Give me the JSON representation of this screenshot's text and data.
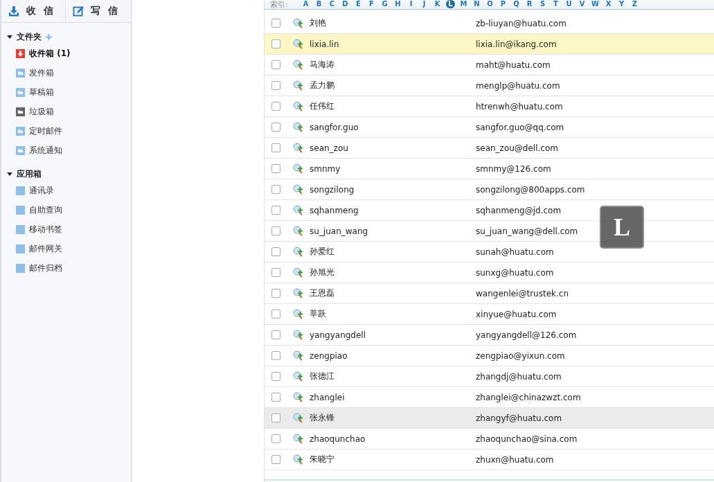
{
  "toolbar": {
    "buttons": [
      {
        "kind": "receive",
        "label": "收 信"
      },
      {
        "kind": "compose",
        "label": "写 信"
      }
    ]
  },
  "sidebar": {
    "sections": [
      {
        "title": "文件夹",
        "expanded": true,
        "can_add": true,
        "items": [
          {
            "kind": "inbox",
            "label": "收件箱",
            "count": "(1)"
          },
          {
            "kind": "folder",
            "label": "发件箱"
          },
          {
            "kind": "folder",
            "label": "草稿箱"
          },
          {
            "kind": "trash",
            "label": "垃圾箱"
          },
          {
            "kind": "folder",
            "label": "定时邮件"
          },
          {
            "kind": "folder",
            "label": "系统通知"
          }
        ]
      },
      {
        "title": "应用箱",
        "expanded": true,
        "items": [
          {
            "kind": "app",
            "label": "通讯录"
          },
          {
            "kind": "app",
            "label": "自助查询"
          },
          {
            "kind": "app",
            "label": "移动书签"
          },
          {
            "kind": "app",
            "label": "邮件网关"
          },
          {
            "kind": "app",
            "label": "邮件归档"
          }
        ]
      }
    ]
  },
  "index_bar": {
    "label": "索引:",
    "letters": [
      {
        "letter": "A",
        "selected": false
      },
      {
        "letter": "B",
        "selected": false
      },
      {
        "letter": "C",
        "selected": false
      },
      {
        "letter": "D",
        "selected": false
      },
      {
        "letter": "E",
        "selected": false
      },
      {
        "letter": "F",
        "selected": false
      },
      {
        "letter": "G",
        "selected": false
      },
      {
        "letter": "H",
        "selected": false
      },
      {
        "letter": "I",
        "selected": false
      },
      {
        "letter": "J",
        "selected": false
      },
      {
        "letter": "K",
        "selected": false
      },
      {
        "letter": "L",
        "selected": true
      },
      {
        "letter": "M",
        "selected": false
      },
      {
        "letter": "N",
        "selected": false
      },
      {
        "letter": "O",
        "selected": false
      },
      {
        "letter": "P",
        "selected": false
      },
      {
        "letter": "Q",
        "selected": false
      },
      {
        "letter": "R",
        "selected": false
      },
      {
        "letter": "S",
        "selected": false
      },
      {
        "letter": "T",
        "selected": false
      },
      {
        "letter": "U",
        "selected": false
      },
      {
        "letter": "V",
        "selected": false
      },
      {
        "letter": "W",
        "selected": false
      },
      {
        "letter": "X",
        "selected": false
      },
      {
        "letter": "Y",
        "selected": false
      },
      {
        "letter": "Z",
        "selected": false
      }
    ]
  },
  "contacts": [
    {
      "name": "刘艳",
      "email": "zb-liuyan@huatu.com",
      "checked": false,
      "selected": false,
      "hovered": false
    },
    {
      "name": "lixia.lin",
      "email": "lixia.lin@ikang.com",
      "checked": false,
      "selected": true,
      "hovered": false
    },
    {
      "name": "马海涛",
      "email": "maht@huatu.com",
      "checked": false,
      "selected": false,
      "hovered": false
    },
    {
      "name": "孟力鹏",
      "email": "menglp@huatu.com",
      "checked": false,
      "selected": false,
      "hovered": false
    },
    {
      "name": "任伟红",
      "email": "htrenwh@huatu.com",
      "checked": false,
      "selected": false,
      "hovered": false
    },
    {
      "name": "sangfor.guo",
      "email": "sangfor.guo@qq.com",
      "checked": false,
      "selected": false,
      "hovered": false
    },
    {
      "name": "sean_zou",
      "email": "sean_zou@dell.com",
      "checked": false,
      "selected": false,
      "hovered": false
    },
    {
      "name": "smnmy",
      "email": "smnmy@126.com",
      "checked": false,
      "selected": false,
      "hovered": false
    },
    {
      "name": "songzilong",
      "email": "songzilong@800apps.com",
      "checked": false,
      "selected": false,
      "hovered": false
    },
    {
      "name": "sqhanmeng",
      "email": "sqhanmeng@jd.com",
      "checked": false,
      "selected": false,
      "hovered": false
    },
    {
      "name": "su_juan_wang",
      "email": "su_juan_wang@dell.com",
      "checked": false,
      "selected": false,
      "hovered": false
    },
    {
      "name": "孙爱红",
      "email": "sunah@huatu.com",
      "checked": false,
      "selected": false,
      "hovered": false
    },
    {
      "name": "孙旭光",
      "email": "sunxg@huatu.com",
      "checked": false,
      "selected": false,
      "hovered": false
    },
    {
      "name": "王恩磊",
      "email": "wangenlei@trustek.cn",
      "checked": false,
      "selected": false,
      "hovered": false
    },
    {
      "name": "莘跃",
      "email": "xinyue@huatu.com",
      "checked": false,
      "selected": false,
      "hovered": false
    },
    {
      "name": "yangyangdell",
      "email": "yangyangdell@126.com",
      "checked": false,
      "selected": false,
      "hovered": false
    },
    {
      "name": "zengpiao",
      "email": "zengpiao@yixun.com",
      "checked": false,
      "selected": false,
      "hovered": false
    },
    {
      "name": "张德江",
      "email": "zhangdj@huatu.com",
      "checked": false,
      "selected": false,
      "hovered": false
    },
    {
      "name": "zhanglei",
      "email": "zhanglei@chinazwzt.com",
      "checked": false,
      "selected": false,
      "hovered": false
    },
    {
      "name": "张永锋",
      "email": "zhangyf@huatu.com",
      "checked": false,
      "selected": false,
      "hovered": true
    },
    {
      "name": "zhaoqunchao",
      "email": "zhaoqunchao@sina.com",
      "checked": false,
      "selected": false,
      "hovered": false
    },
    {
      "name": "朱晓宁",
      "email": "zhuxn@huatu.com",
      "checked": false,
      "selected": false,
      "hovered": false
    }
  ],
  "letter_popup": {
    "letter": "L"
  }
}
